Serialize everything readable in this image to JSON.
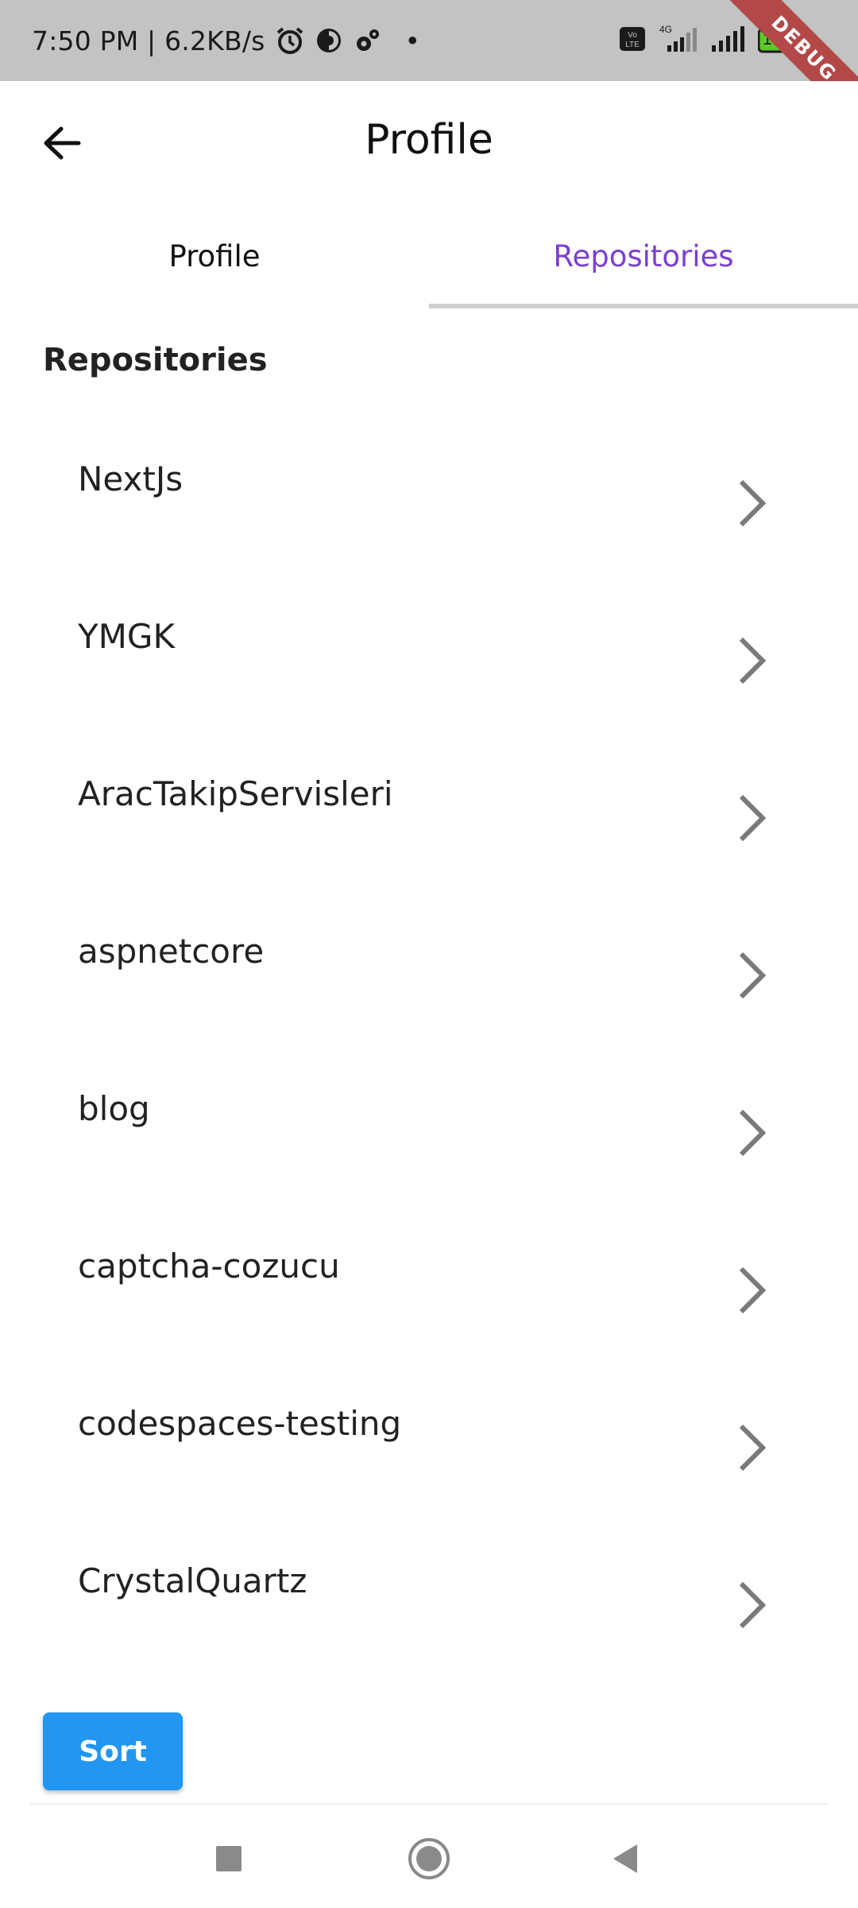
{
  "status_bar": {
    "time_speed": "7:50 PM | 6.2KB/s",
    "dot": "•",
    "network": "4G",
    "volte": "Vo LTE",
    "battery": "100",
    "debug": "DEBUG"
  },
  "app_bar": {
    "title": "Profile"
  },
  "tabs": [
    {
      "label": "Profile",
      "active": false
    },
    {
      "label": "Repositories",
      "active": true
    }
  ],
  "section_title": "Repositories",
  "repositories": [
    {
      "name": "NextJs"
    },
    {
      "name": "YMGK"
    },
    {
      "name": "AracTakipServisleri"
    },
    {
      "name": "aspnetcore"
    },
    {
      "name": "blog"
    },
    {
      "name": "captcha-cozucu"
    },
    {
      "name": "codespaces-testing"
    },
    {
      "name": "CrystalQuartz"
    }
  ],
  "sort_button": "Sort",
  "colors": {
    "accent": "#7c3fd3",
    "button": "#2196f3",
    "status_bar": "#c3c3c3",
    "debug": "#b24848"
  },
  "icons": {
    "back": "arrow-back-icon",
    "chevron": "chevron-right-icon",
    "nav_recent": "square-icon",
    "nav_home": "circle-icon",
    "nav_back": "triangle-back-icon"
  }
}
